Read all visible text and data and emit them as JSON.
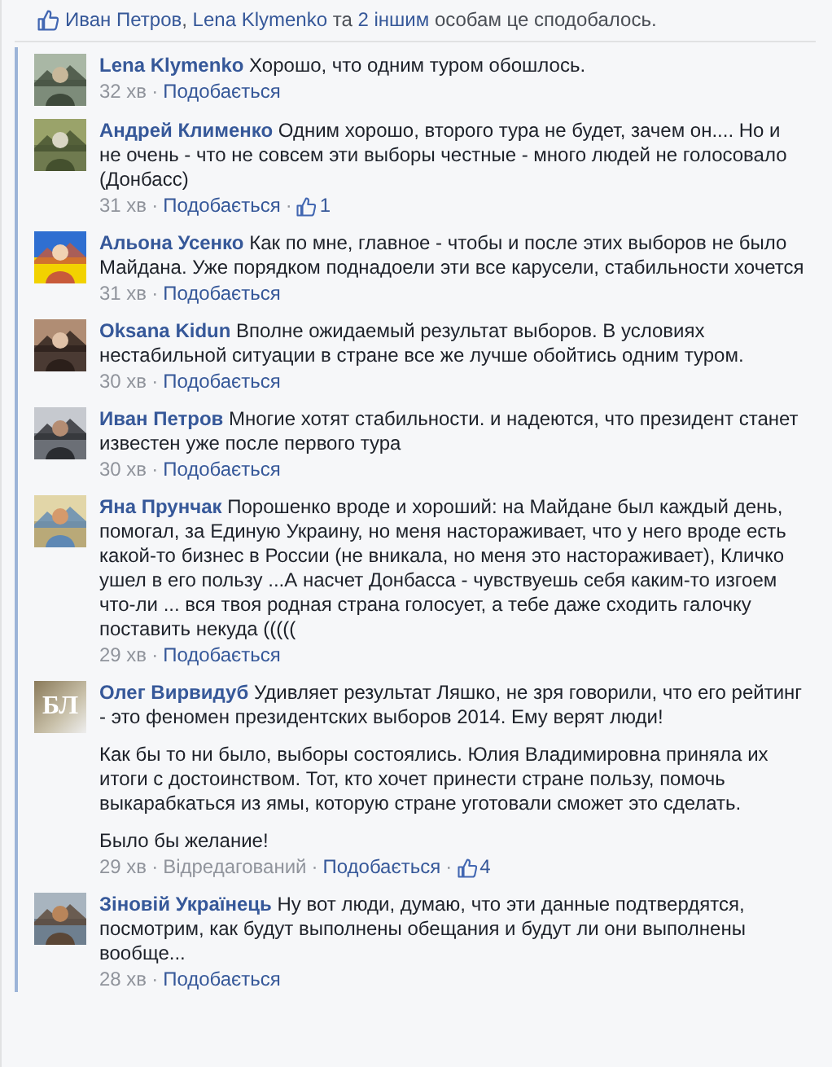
{
  "likes_summary": {
    "parts": [
      {
        "text": "Иван Петров",
        "link": true
      },
      {
        "text": ", ",
        "link": false
      },
      {
        "text": "Lena Klymenko",
        "link": true
      },
      {
        "text": " та ",
        "link": false
      },
      {
        "text": "2 іншим",
        "link": true
      },
      {
        "text": " особам це сподобалось.",
        "link": false
      }
    ]
  },
  "separator": "·",
  "comments": [
    {
      "author": "Lena Klymenko",
      "paragraphs": [
        "Хорошо, что одним туром обошлось."
      ],
      "time": "32 хв",
      "like_label": "Подобається"
    },
    {
      "author": "Андрей Клименко",
      "paragraphs": [
        "Одним хорошо, второго тура не будет, зачем он.... Но и не очень - что не совсем эти выборы честные - много людей не голосовало (Донбасс)"
      ],
      "time": "31 хв",
      "like_label": "Подобається",
      "likes": "1"
    },
    {
      "author": "Альона Усенко",
      "paragraphs": [
        "Как по мне, главное - чтобы и после этих выборов не было Майдана. Уже порядком поднадоели эти все карусели, стабильности хочется"
      ],
      "time": "31 хв",
      "like_label": "Подобається"
    },
    {
      "author": "Oksana Kidun",
      "paragraphs": [
        "Вполне ожидаемый результат выборов. В условиях нестабильной ситуации в стране все же лучше обойтись одним туром."
      ],
      "time": "30 хв",
      "like_label": "Подобається"
    },
    {
      "author": "Иван Петров",
      "paragraphs": [
        "Многие хотят стабильности. и надеются, что президент станет известен уже после первого тура"
      ],
      "time": "30 хв",
      "like_label": "Подобається"
    },
    {
      "author": "Яна Прунчак",
      "paragraphs": [
        "Порошенко вроде и хороший: на Майдане был каждый день, помогал, за Единую Украину, но меня настораживает, что у него вроде есть какой-то бизнес в России (не вникала, но меня это настораживает), Кличко ушел в его пользу ...А насчет Донбасса - чувствуешь себя каким-то изгоем что-ли ... вся твоя родная страна голосует, а тебе даже сходить галочку поставить некуда ((((("
      ],
      "time": "29 хв",
      "like_label": "Подобається"
    },
    {
      "author": "Олег Вирвидуб",
      "avatar": {
        "kind": "logo",
        "text": "БЛ"
      },
      "paragraphs": [
        "Удивляет результат Ляшко, не зря говорили, что его рейтинг - это феномен президентских выборов 2014. Ему верят люди!",
        "Как бы то ни было, выборы состоялись. Юлия Владимировна приняла их итоги с достоинством. Тот, кто хочет принести стране пользу, помочь выкарабкаться из ямы, которую стране уготовали сможет это сделать.",
        "Было бы желание!"
      ],
      "time": "29 хв",
      "edited": "Відредагований",
      "like_label": "Подобається",
      "likes": "4"
    },
    {
      "author": "Зіновій Українець",
      "paragraphs": [
        "Ну вот люди, думаю, что эти данные подтвердятся, посмотрим, как будут выполнены обещания и будут ли они выполнены вообще..."
      ],
      "time": "28 хв",
      "like_label": "Подобається"
    }
  ]
}
